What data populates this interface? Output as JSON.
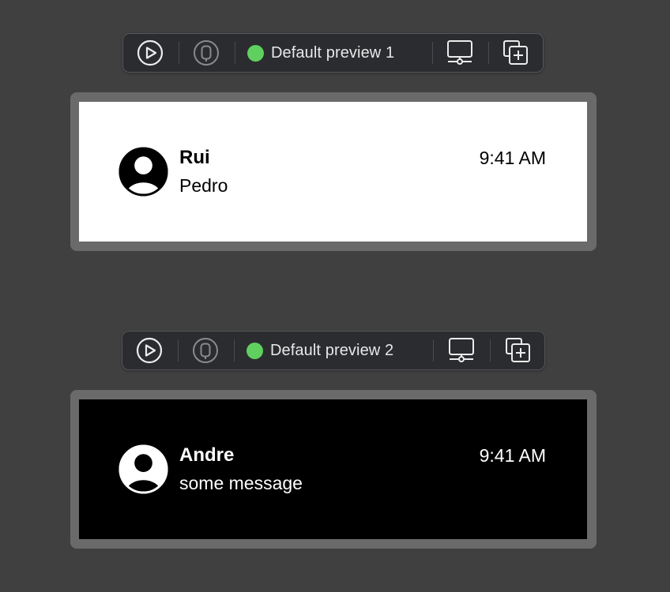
{
  "previews": [
    {
      "toolbar": {
        "label": "Default preview 1",
        "status_color": "#5fd05f",
        "icons": [
          "play-icon",
          "device-icon",
          "status-dot",
          "display-settings-icon",
          "duplicate-icon"
        ]
      },
      "appearance": "light",
      "row": {
        "name": "Rui",
        "message": "Pedro",
        "time": "9:41 AM",
        "avatar_icon": "person-circle-icon"
      }
    },
    {
      "toolbar": {
        "label": "Default preview 2",
        "status_color": "#5fd05f",
        "icons": [
          "play-icon",
          "device-icon",
          "status-dot",
          "display-settings-icon",
          "duplicate-icon"
        ]
      },
      "appearance": "dark",
      "row": {
        "name": "Andre",
        "message": "some message",
        "time": "9:41 AM",
        "avatar_icon": "person-circle-icon"
      }
    }
  ],
  "colors": {
    "canvas_background": "#404040",
    "toolbar_background": "#2b2c30",
    "frame_border": "#6a6a6a",
    "status_green": "#5fd05f"
  }
}
